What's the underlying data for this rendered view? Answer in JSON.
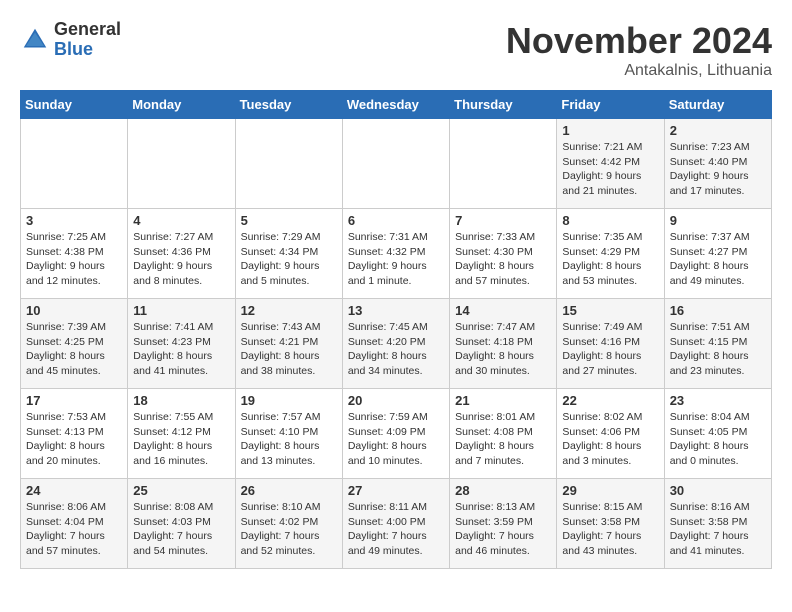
{
  "logo": {
    "general": "General",
    "blue": "Blue"
  },
  "title": "November 2024",
  "location": "Antakalnis, Lithuania",
  "days_header": [
    "Sunday",
    "Monday",
    "Tuesday",
    "Wednesday",
    "Thursday",
    "Friday",
    "Saturday"
  ],
  "weeks": [
    [
      {
        "day": "",
        "sunrise": "",
        "sunset": "",
        "daylight": ""
      },
      {
        "day": "",
        "sunrise": "",
        "sunset": "",
        "daylight": ""
      },
      {
        "day": "",
        "sunrise": "",
        "sunset": "",
        "daylight": ""
      },
      {
        "day": "",
        "sunrise": "",
        "sunset": "",
        "daylight": ""
      },
      {
        "day": "",
        "sunrise": "",
        "sunset": "",
        "daylight": ""
      },
      {
        "day": "1",
        "sunrise": "Sunrise: 7:21 AM",
        "sunset": "Sunset: 4:42 PM",
        "daylight": "Daylight: 9 hours and 21 minutes."
      },
      {
        "day": "2",
        "sunrise": "Sunrise: 7:23 AM",
        "sunset": "Sunset: 4:40 PM",
        "daylight": "Daylight: 9 hours and 17 minutes."
      }
    ],
    [
      {
        "day": "3",
        "sunrise": "Sunrise: 7:25 AM",
        "sunset": "Sunset: 4:38 PM",
        "daylight": "Daylight: 9 hours and 12 minutes."
      },
      {
        "day": "4",
        "sunrise": "Sunrise: 7:27 AM",
        "sunset": "Sunset: 4:36 PM",
        "daylight": "Daylight: 9 hours and 8 minutes."
      },
      {
        "day": "5",
        "sunrise": "Sunrise: 7:29 AM",
        "sunset": "Sunset: 4:34 PM",
        "daylight": "Daylight: 9 hours and 5 minutes."
      },
      {
        "day": "6",
        "sunrise": "Sunrise: 7:31 AM",
        "sunset": "Sunset: 4:32 PM",
        "daylight": "Daylight: 9 hours and 1 minute."
      },
      {
        "day": "7",
        "sunrise": "Sunrise: 7:33 AM",
        "sunset": "Sunset: 4:30 PM",
        "daylight": "Daylight: 8 hours and 57 minutes."
      },
      {
        "day": "8",
        "sunrise": "Sunrise: 7:35 AM",
        "sunset": "Sunset: 4:29 PM",
        "daylight": "Daylight: 8 hours and 53 minutes."
      },
      {
        "day": "9",
        "sunrise": "Sunrise: 7:37 AM",
        "sunset": "Sunset: 4:27 PM",
        "daylight": "Daylight: 8 hours and 49 minutes."
      }
    ],
    [
      {
        "day": "10",
        "sunrise": "Sunrise: 7:39 AM",
        "sunset": "Sunset: 4:25 PM",
        "daylight": "Daylight: 8 hours and 45 minutes."
      },
      {
        "day": "11",
        "sunrise": "Sunrise: 7:41 AM",
        "sunset": "Sunset: 4:23 PM",
        "daylight": "Daylight: 8 hours and 41 minutes."
      },
      {
        "day": "12",
        "sunrise": "Sunrise: 7:43 AM",
        "sunset": "Sunset: 4:21 PM",
        "daylight": "Daylight: 8 hours and 38 minutes."
      },
      {
        "day": "13",
        "sunrise": "Sunrise: 7:45 AM",
        "sunset": "Sunset: 4:20 PM",
        "daylight": "Daylight: 8 hours and 34 minutes."
      },
      {
        "day": "14",
        "sunrise": "Sunrise: 7:47 AM",
        "sunset": "Sunset: 4:18 PM",
        "daylight": "Daylight: 8 hours and 30 minutes."
      },
      {
        "day": "15",
        "sunrise": "Sunrise: 7:49 AM",
        "sunset": "Sunset: 4:16 PM",
        "daylight": "Daylight: 8 hours and 27 minutes."
      },
      {
        "day": "16",
        "sunrise": "Sunrise: 7:51 AM",
        "sunset": "Sunset: 4:15 PM",
        "daylight": "Daylight: 8 hours and 23 minutes."
      }
    ],
    [
      {
        "day": "17",
        "sunrise": "Sunrise: 7:53 AM",
        "sunset": "Sunset: 4:13 PM",
        "daylight": "Daylight: 8 hours and 20 minutes."
      },
      {
        "day": "18",
        "sunrise": "Sunrise: 7:55 AM",
        "sunset": "Sunset: 4:12 PM",
        "daylight": "Daylight: 8 hours and 16 minutes."
      },
      {
        "day": "19",
        "sunrise": "Sunrise: 7:57 AM",
        "sunset": "Sunset: 4:10 PM",
        "daylight": "Daylight: 8 hours and 13 minutes."
      },
      {
        "day": "20",
        "sunrise": "Sunrise: 7:59 AM",
        "sunset": "Sunset: 4:09 PM",
        "daylight": "Daylight: 8 hours and 10 minutes."
      },
      {
        "day": "21",
        "sunrise": "Sunrise: 8:01 AM",
        "sunset": "Sunset: 4:08 PM",
        "daylight": "Daylight: 8 hours and 7 minutes."
      },
      {
        "day": "22",
        "sunrise": "Sunrise: 8:02 AM",
        "sunset": "Sunset: 4:06 PM",
        "daylight": "Daylight: 8 hours and 3 minutes."
      },
      {
        "day": "23",
        "sunrise": "Sunrise: 8:04 AM",
        "sunset": "Sunset: 4:05 PM",
        "daylight": "Daylight: 8 hours and 0 minutes."
      }
    ],
    [
      {
        "day": "24",
        "sunrise": "Sunrise: 8:06 AM",
        "sunset": "Sunset: 4:04 PM",
        "daylight": "Daylight: 7 hours and 57 minutes."
      },
      {
        "day": "25",
        "sunrise": "Sunrise: 8:08 AM",
        "sunset": "Sunset: 4:03 PM",
        "daylight": "Daylight: 7 hours and 54 minutes."
      },
      {
        "day": "26",
        "sunrise": "Sunrise: 8:10 AM",
        "sunset": "Sunset: 4:02 PM",
        "daylight": "Daylight: 7 hours and 52 minutes."
      },
      {
        "day": "27",
        "sunrise": "Sunrise: 8:11 AM",
        "sunset": "Sunset: 4:00 PM",
        "daylight": "Daylight: 7 hours and 49 minutes."
      },
      {
        "day": "28",
        "sunrise": "Sunrise: 8:13 AM",
        "sunset": "Sunset: 3:59 PM",
        "daylight": "Daylight: 7 hours and 46 minutes."
      },
      {
        "day": "29",
        "sunrise": "Sunrise: 8:15 AM",
        "sunset": "Sunset: 3:58 PM",
        "daylight": "Daylight: 7 hours and 43 minutes."
      },
      {
        "day": "30",
        "sunrise": "Sunrise: 8:16 AM",
        "sunset": "Sunset: 3:58 PM",
        "daylight": "Daylight: 7 hours and 41 minutes."
      }
    ]
  ]
}
